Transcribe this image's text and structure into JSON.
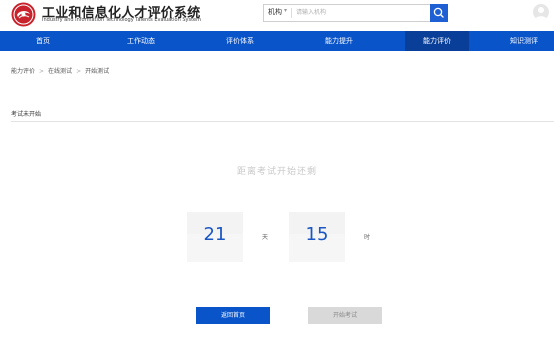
{
  "brand": {
    "title": "工业和信息化人才评价系统",
    "subtitle": "Industry and Information Technology Talents Evaluation System",
    "logo_icon": "logo-emblem"
  },
  "search": {
    "scope": "机构",
    "scope_caret": "▾",
    "placeholder": "请输入机构",
    "button_icon": "search-icon"
  },
  "user": {
    "avatar_icon": "user-avatar-icon"
  },
  "nav": {
    "items": [
      {
        "label": "首页"
      },
      {
        "label": "工作动态"
      },
      {
        "label": "评价体系"
      },
      {
        "label": "能力提升"
      },
      {
        "label": "能力评价",
        "active": true
      },
      {
        "label": "知识测评"
      }
    ],
    "active_color": "#0a3f99",
    "bar_color": "#0a54c9"
  },
  "breadcrumb": {
    "items": [
      "能力评价",
      "在线测试",
      "开始测试"
    ],
    "separator": ">"
  },
  "status": {
    "label": "考试未开始"
  },
  "countdown": {
    "title": "距离考试开始还剩",
    "days": "21",
    "days_unit": "天",
    "hours": "15",
    "hours_unit": "时"
  },
  "actions": {
    "back_label": "返回首页",
    "start_label": "开始考试"
  }
}
